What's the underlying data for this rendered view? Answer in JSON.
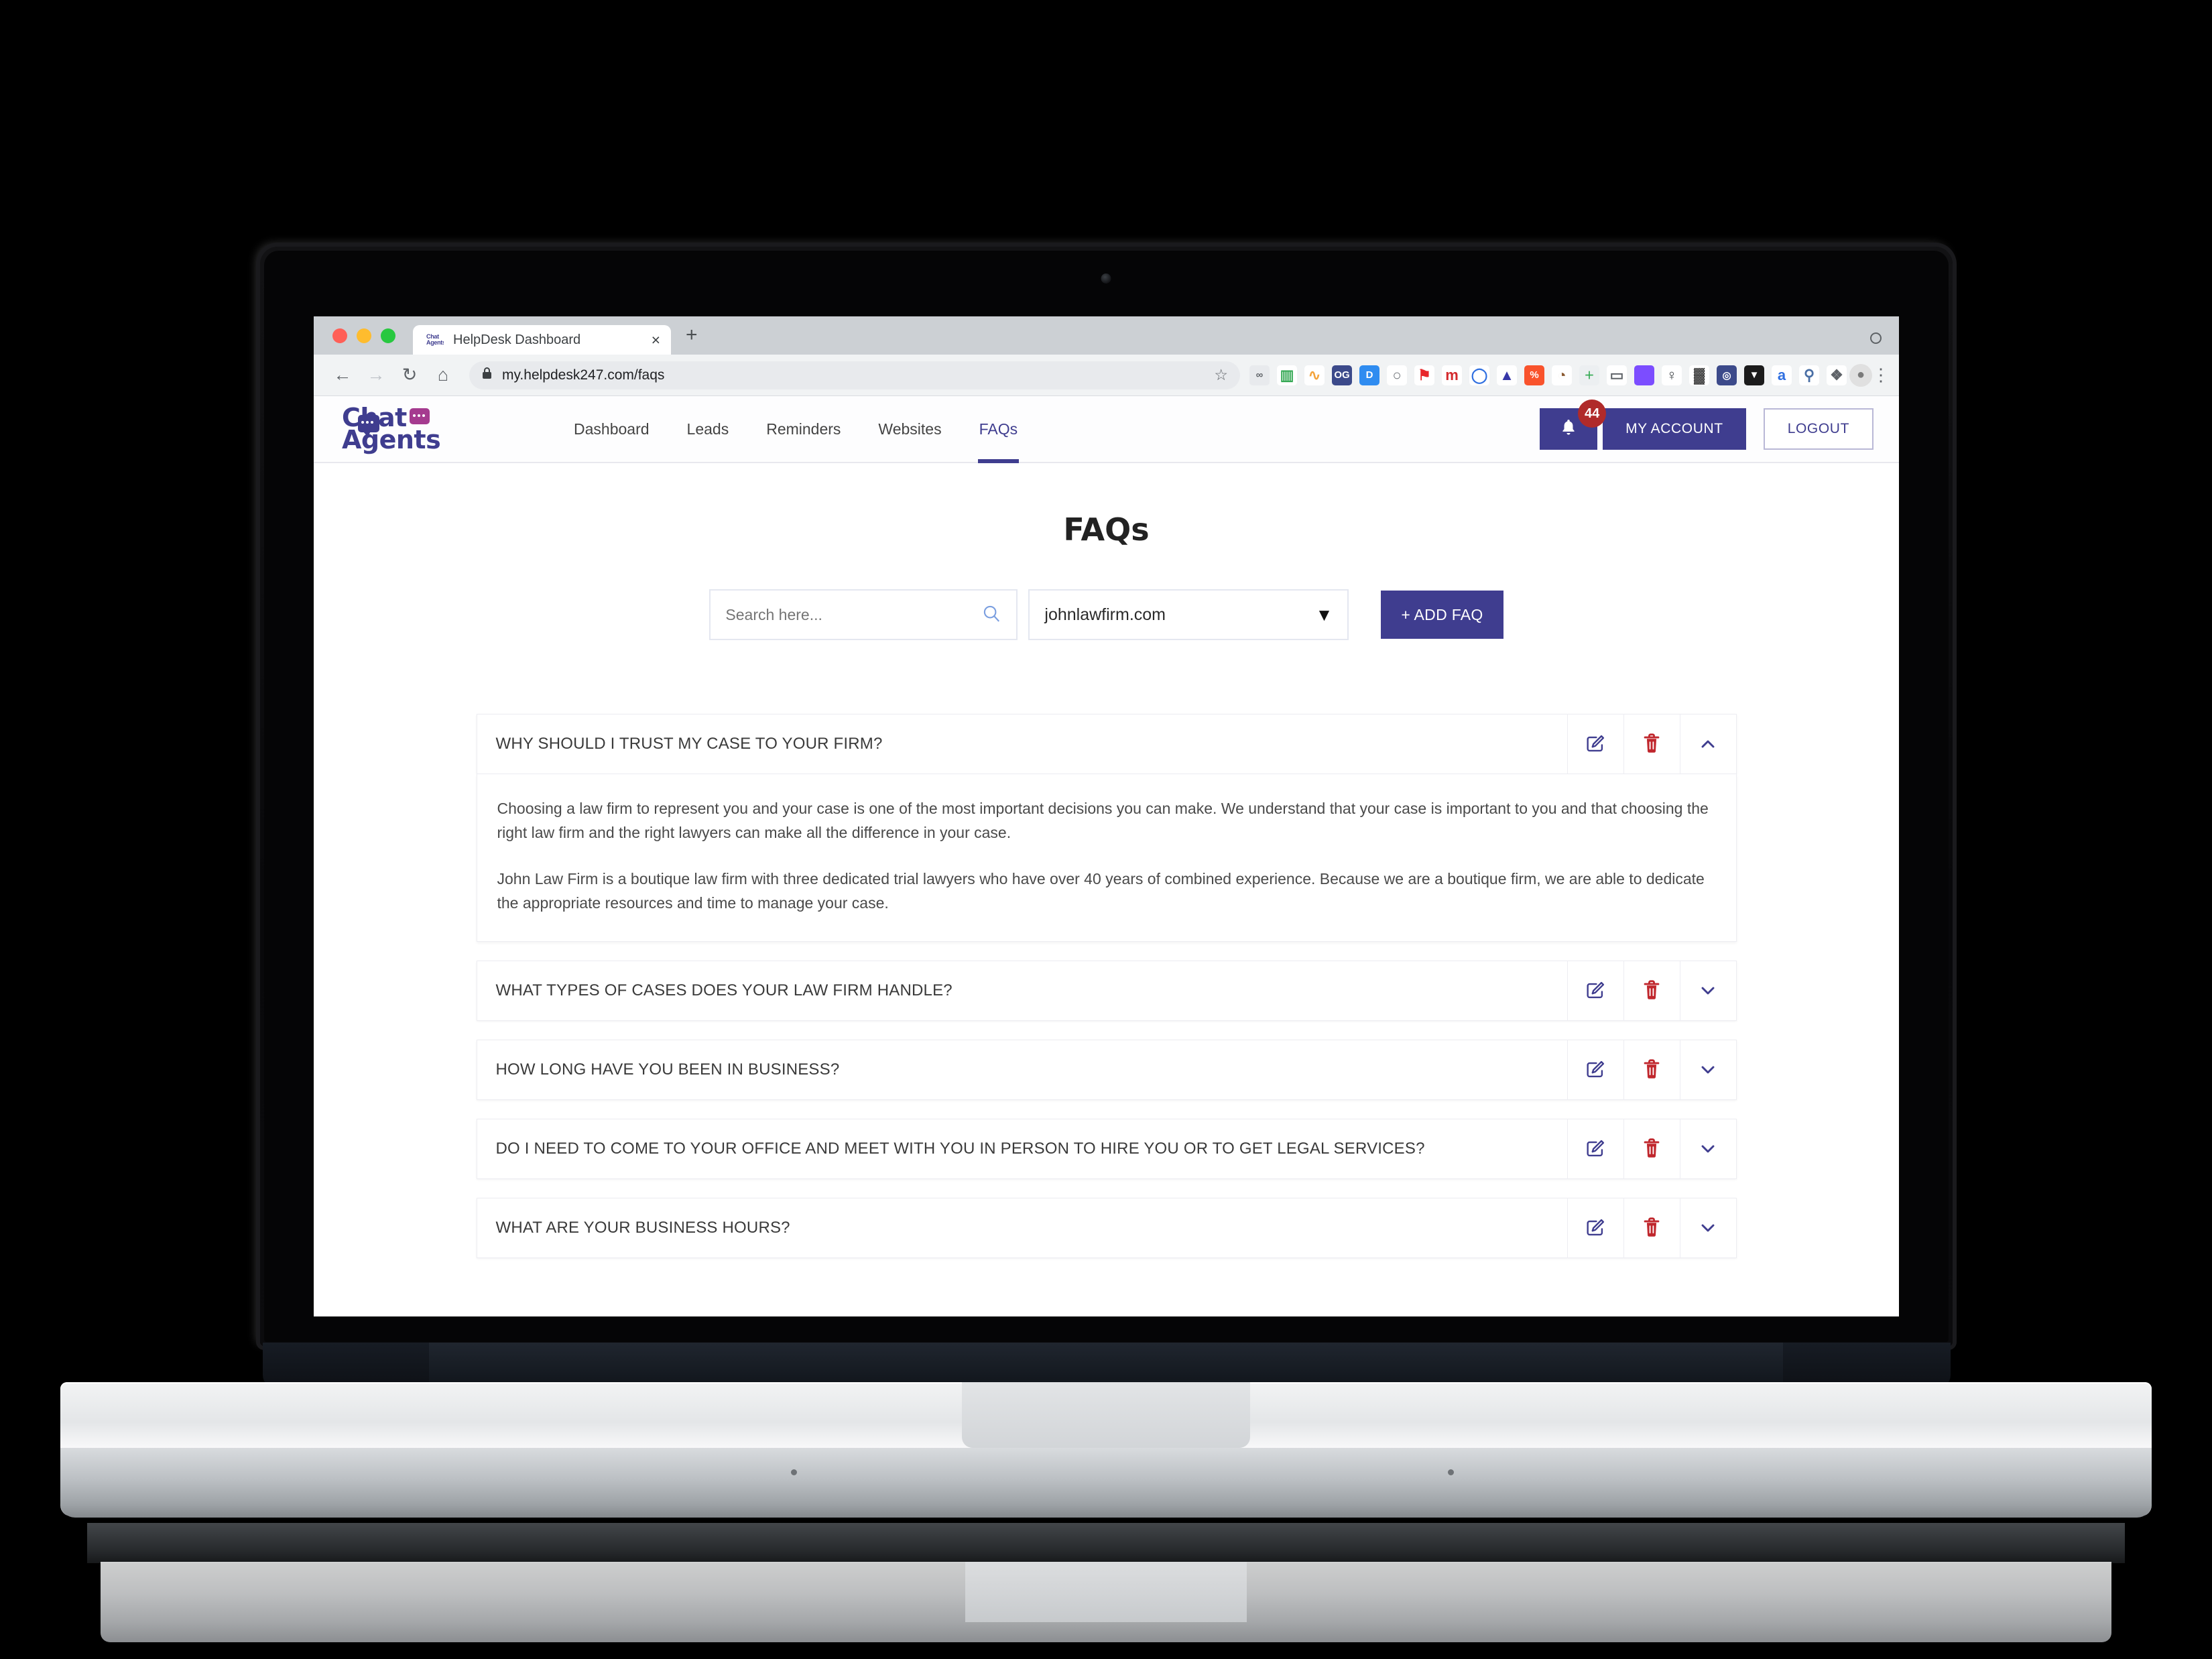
{
  "browser": {
    "tab": {
      "title": "HelpDesk Dashboard",
      "favicon_top": "Chat",
      "favicon_bottom": "Agents",
      "close": "×"
    },
    "newtab_label": "+",
    "nav": {
      "back": "←",
      "forward": "→",
      "reload": "↻",
      "home": "⌂"
    },
    "omnibox": {
      "lock": "🔒",
      "url": "my.helpdesk247.com/faqs",
      "star": "☆"
    },
    "extensions": [
      {
        "name": "link-extension-icon",
        "glyph": "∞",
        "bg": "#e8eaed",
        "fg": "#5f6368"
      },
      {
        "name": "spreadsheet-extension-icon",
        "glyph": "▥",
        "bg": "#ffffff",
        "fg": "#34a853"
      },
      {
        "name": "analytics-extension-icon",
        "glyph": "∿",
        "bg": "#ffffff",
        "fg": "#f4a33a"
      },
      {
        "name": "og-extension-icon",
        "glyph": "OG",
        "bg": "#3c4a8a",
        "fg": "#ffffff"
      },
      {
        "name": "d-extension-icon",
        "glyph": "D",
        "bg": "#2f8cf0",
        "fg": "#ffffff"
      },
      {
        "name": "ghost-extension-icon",
        "glyph": "○",
        "bg": "#ffffff",
        "fg": "#6b7075"
      },
      {
        "name": "red-flag-extension-icon",
        "glyph": "⚑",
        "bg": "#ffffff",
        "fg": "#e8262a"
      },
      {
        "name": "m-extension-icon",
        "glyph": "m",
        "bg": "#ffffff",
        "fg": "#d3292c"
      },
      {
        "name": "ring-extension-icon",
        "glyph": "◯",
        "bg": "#ffffff",
        "fg": "#2f6fe0"
      },
      {
        "name": "triangle-extension-icon",
        "glyph": "▲",
        "bg": "#ffffff",
        "fg": "#3637a8"
      },
      {
        "name": "percent-extension-icon",
        "glyph": "%",
        "bg": "#f9532c",
        "fg": "#ffffff"
      },
      {
        "name": "dog-extension-icon",
        "glyph": "◔",
        "bg": "#ffffff",
        "fg": "#8a5a32"
      },
      {
        "name": "add-extension-icon",
        "glyph": "＋",
        "bg": "#eceff1",
        "fg": "#2fa84f"
      },
      {
        "name": "robot-extension-icon",
        "glyph": "▭",
        "bg": "#ffffff",
        "fg": "#5f6368"
      },
      {
        "name": "color-squares-extension-icon",
        "glyph": "",
        "bg": "#7c4dff",
        "fg": "#ffffff"
      },
      {
        "name": "person-extension-icon",
        "glyph": "♀",
        "bg": "#ffffff",
        "fg": "#3c4043"
      },
      {
        "name": "graffiti-extension-icon",
        "glyph": "▓",
        "bg": "#ffffff",
        "fg": "#222222"
      },
      {
        "name": "spiral-extension-icon",
        "glyph": "◎",
        "bg": "#3c4a8a",
        "fg": "#ffffff"
      },
      {
        "name": "shield-extension-icon",
        "glyph": "▼",
        "bg": "#1b1b1b",
        "fg": "#ffffff"
      },
      {
        "name": "amazon-extension-icon",
        "glyph": "a",
        "bg": "#ffffff",
        "fg": "#2f6fe0"
      },
      {
        "name": "magnifier-extension-icon",
        "glyph": "⚲",
        "bg": "#ffffff",
        "fg": "#4a6fa5"
      },
      {
        "name": "puzzle-extension-icon",
        "glyph": "❖",
        "bg": "#ffffff",
        "fg": "#5f6368"
      }
    ],
    "profile_glyph": "●",
    "menu_glyph": "⋮"
  },
  "app": {
    "logo": {
      "line1": "Chat",
      "line2": "Agents"
    },
    "nav_items": [
      {
        "label": "Dashboard",
        "active": false
      },
      {
        "label": "Leads",
        "active": false
      },
      {
        "label": "Reminders",
        "active": false
      },
      {
        "label": "Websites",
        "active": false
      },
      {
        "label": "FAQs",
        "active": true
      }
    ],
    "notifications": {
      "count": "44",
      "icon": "bell-icon"
    },
    "account_button": "MY ACCOUNT",
    "logout_button": "LOGOUT",
    "page_title": "FAQs",
    "search": {
      "placeholder": "Search here...",
      "value": "",
      "icon": "search-icon"
    },
    "website_select": {
      "value": "johnlawfirm.com",
      "caret": "▼"
    },
    "add_faq_button": "+ ADD FAQ",
    "row_actions": {
      "edit": "edit-icon",
      "delete": "trash-icon",
      "expand": "chevron-down-icon",
      "collapse": "chevron-up-icon"
    },
    "faqs": [
      {
        "question": "WHY SHOULD I TRUST MY CASE TO YOUR FIRM?",
        "expanded": true,
        "answer": [
          "Choosing a law firm to represent you and your case is one of the most important decisions you can make. We understand that your case is important to you and that choosing the right law firm and the right lawyers can make all the difference in your case.",
          "John Law Firm is a boutique law firm with three dedicated trial lawyers who have over 40 years of combined experience. Because we are a boutique firm, we are able to dedicate the appropriate resources and time to manage your case."
        ]
      },
      {
        "question": "WHAT TYPES OF CASES DOES YOUR LAW FIRM HANDLE?",
        "expanded": false,
        "answer": []
      },
      {
        "question": "HOW LONG HAVE YOU BEEN IN BUSINESS?",
        "expanded": false,
        "answer": []
      },
      {
        "question": "DO I NEED TO COME TO YOUR OFFICE AND MEET WITH YOU IN PERSON TO HIRE YOU OR TO GET LEGAL SERVICES?",
        "expanded": false,
        "answer": []
      },
      {
        "question": "WHAT ARE YOUR BUSINESS HOURS?",
        "expanded": false,
        "answer": []
      }
    ]
  },
  "colors": {
    "brand": "#3f3d8f",
    "accent_pink": "#a53b8f",
    "danger": "#b02a2a",
    "delete_icon": "#c0272d",
    "text": "#3a3a3a"
  }
}
